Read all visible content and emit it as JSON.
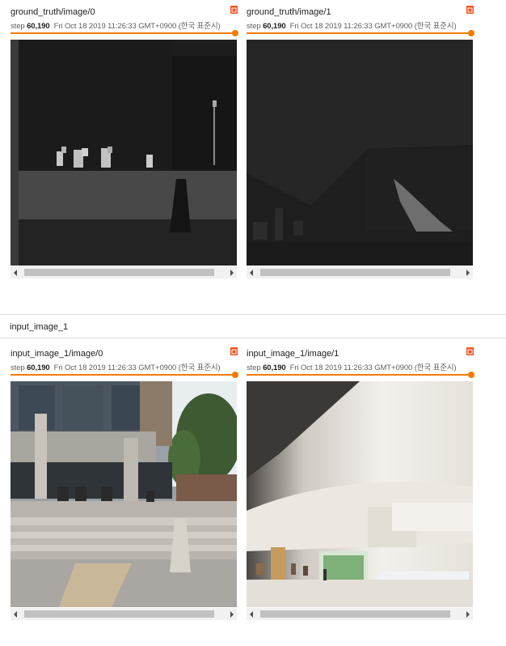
{
  "sections": [
    {
      "label": "",
      "cards": [
        {
          "title": "ground_truth/image/0",
          "step_label": "step",
          "step_value": "60,190",
          "timestamp": "Fri Oct 18 2019 11:26:33 GMT+0900 (한국 표준시)"
        },
        {
          "title": "ground_truth/image/1",
          "step_label": "step",
          "step_value": "60,190",
          "timestamp": "Fri Oct 18 2019 11:26:33 GMT+0900 (한국 표준시)"
        }
      ]
    },
    {
      "label": "input_image_1",
      "cards": [
        {
          "title": "input_image_1/image/0",
          "step_label": "step",
          "step_value": "60,190",
          "timestamp": "Fri Oct 18 2019 11:26:33 GMT+0900 (한국 표준시)"
        },
        {
          "title": "input_image_1/image/1",
          "step_label": "step",
          "step_value": "60,190",
          "timestamp": "Fri Oct 18 2019 11:26:33 GMT+0900 (한국 표준시)"
        }
      ]
    }
  ],
  "icons": {
    "expand": "expand-icon",
    "scroll_left": "scroll-left-arrow-icon",
    "scroll_right": "scroll-right-arrow-icon"
  },
  "colors": {
    "accent": "#f57c00",
    "expand_button": "#f4511e",
    "scrollbar_track": "#f1f1f1",
    "scrollbar_thumb": "#c1c1c1"
  }
}
